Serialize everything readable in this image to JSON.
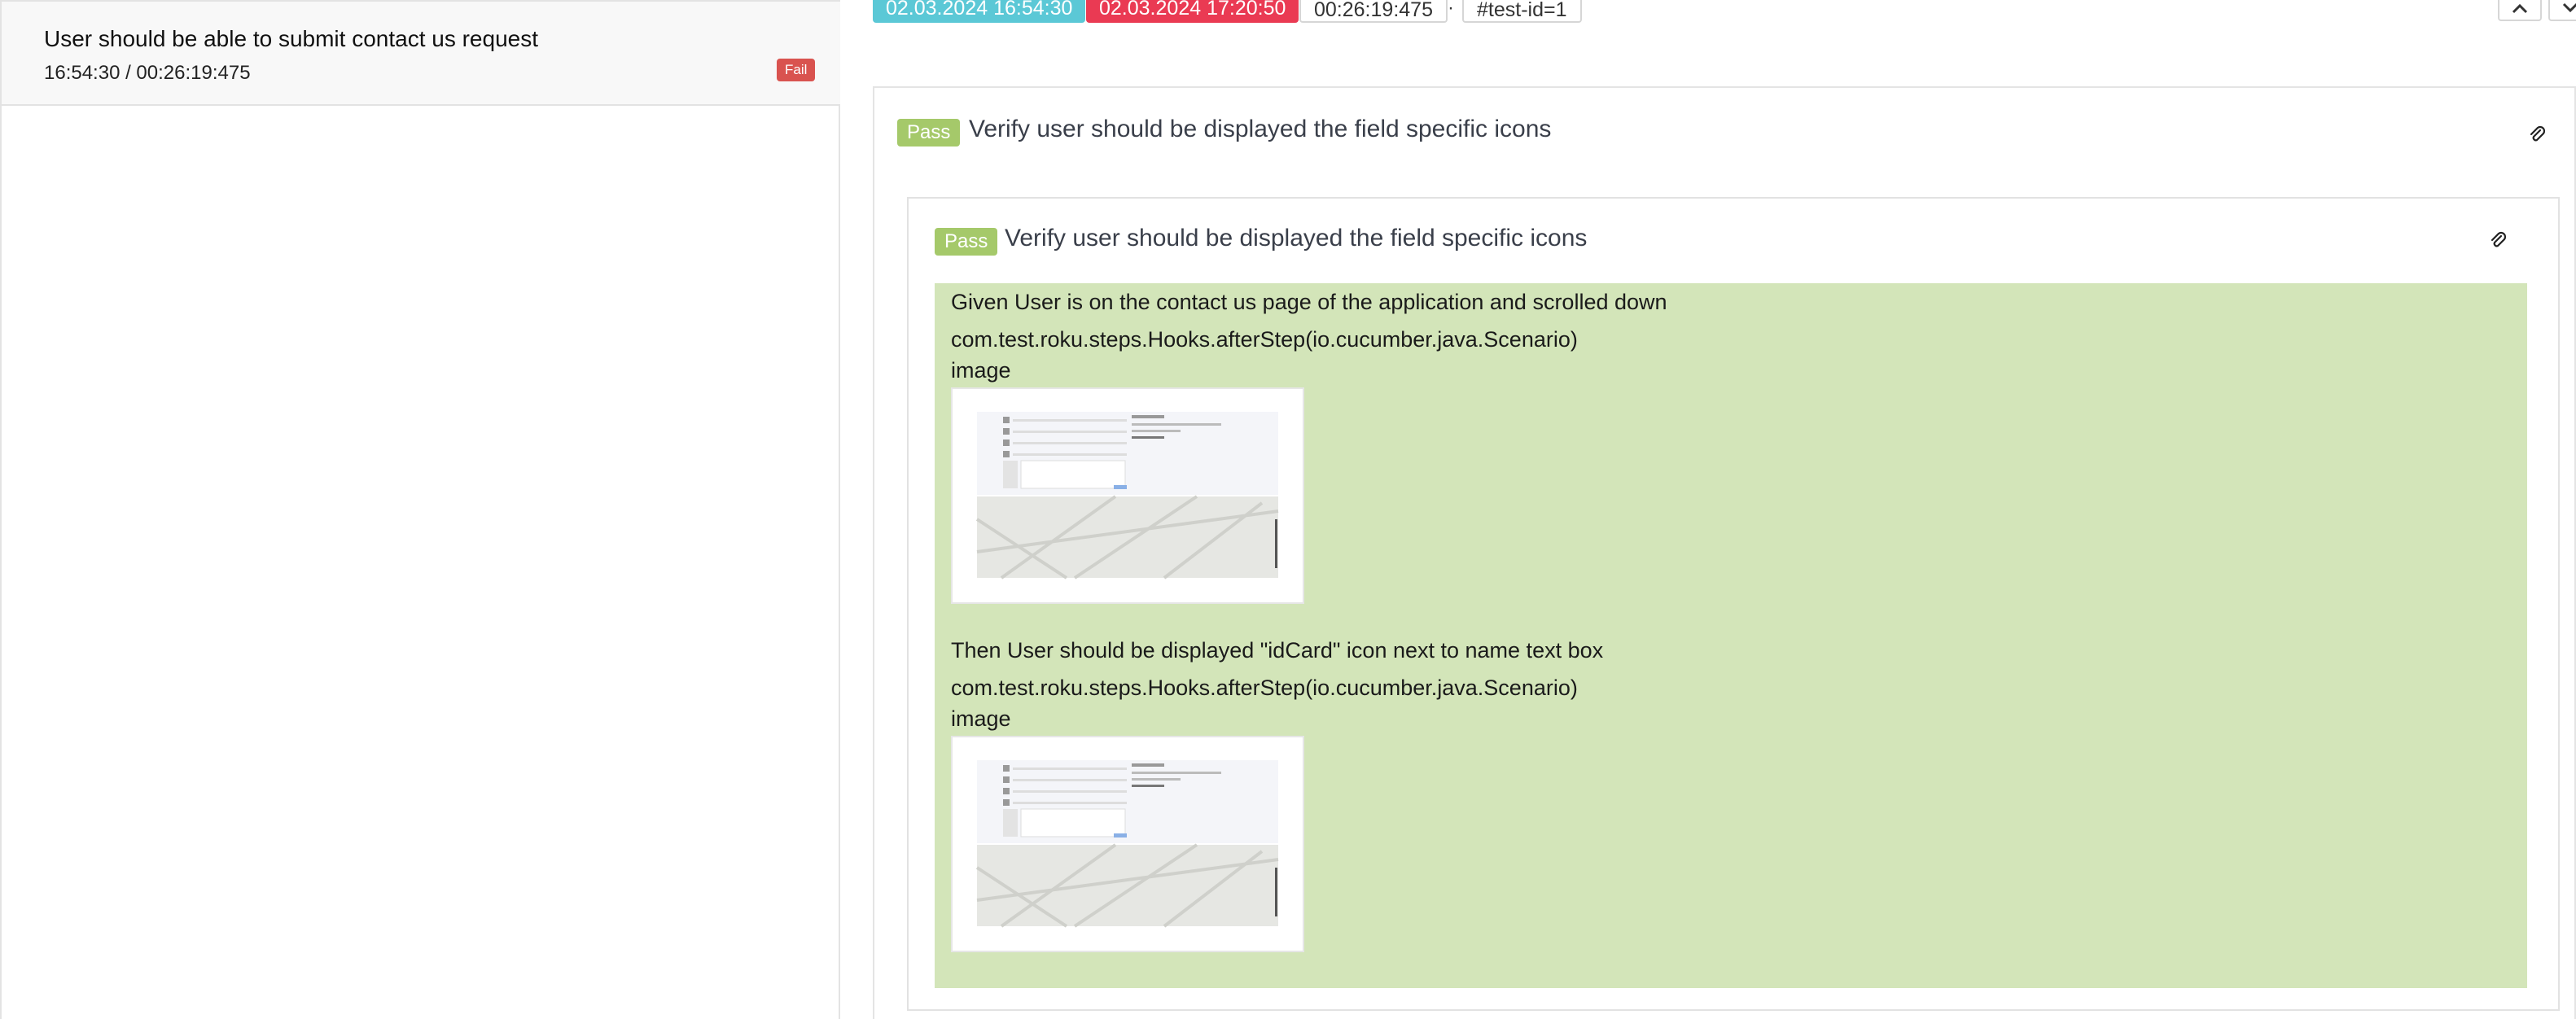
{
  "left_panel": {
    "test": {
      "title": "User should be able to submit contact us request",
      "meta": "16:54:30 / 00:26:19:475",
      "status": "Fail"
    }
  },
  "header": {
    "start_time": "02.03.2024 16:54:30",
    "end_time": "02.03.2024 17:20:50",
    "duration": "00:26:19:475",
    "separator": "·",
    "test_id": "#test-id=1",
    "icons": {
      "up": "chevron-up-icon",
      "down": "chevron-down-icon"
    }
  },
  "scenario": {
    "status": "Pass",
    "title": "Verify user should be displayed the field specific icons",
    "inner": {
      "status": "Pass",
      "title": "Verify user should be displayed the field specific icons",
      "steps": [
        {
          "text": "Given User is on the contact us page of the application and scrolled down",
          "hook": "com.test.roku.steps.Hooks.afterStep(io.cucumber.java.Scenario)",
          "attachment_label": "image"
        },
        {
          "text": "Then User should be displayed \"idCard\" icon next to name text box",
          "hook": "com.test.roku.steps.Hooks.afterStep(io.cucumber.java.Scenario)",
          "attachment_label": "image"
        }
      ]
    }
  },
  "colors": {
    "pass": "#a5c96a",
    "fail": "#d9534f",
    "start_chip": "#5bc8d6",
    "end_chip": "#ea3a53",
    "step_background": "#d3e5b9"
  }
}
